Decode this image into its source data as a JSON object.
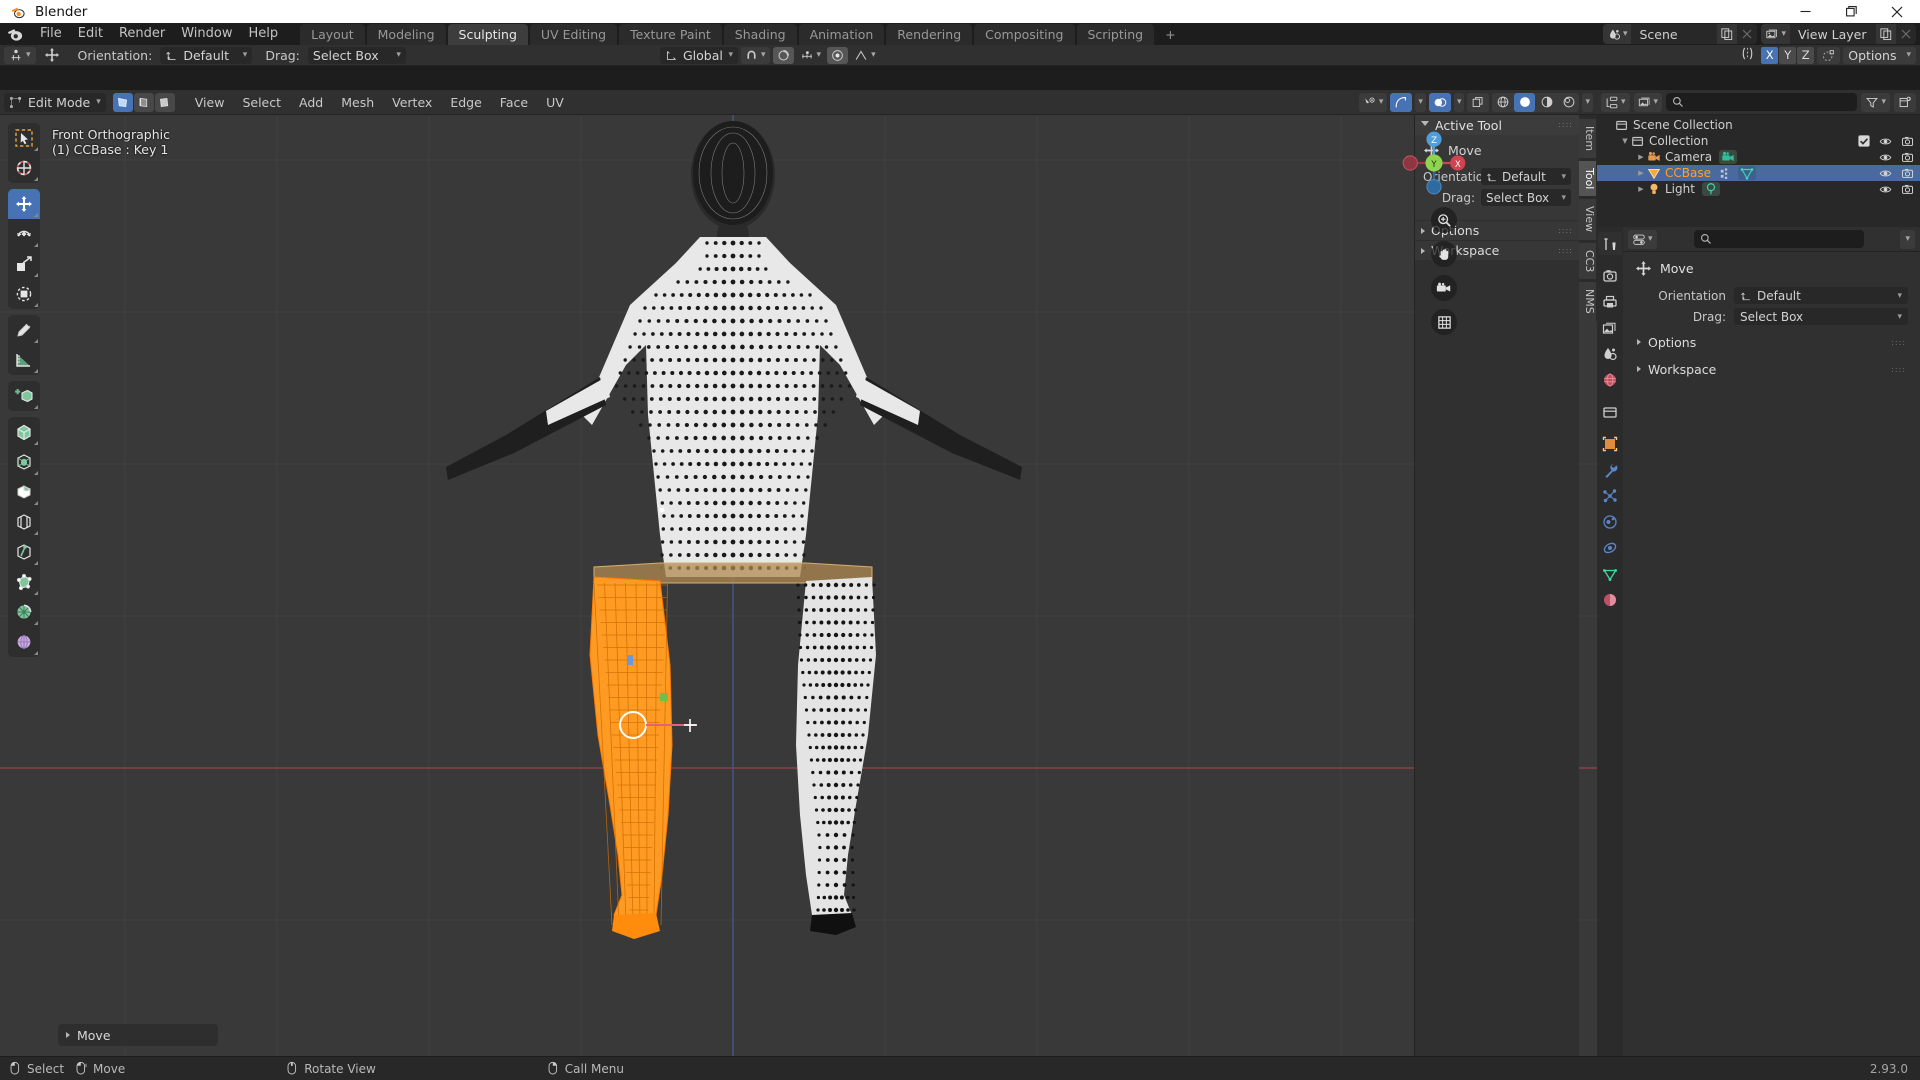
{
  "window": {
    "title": "Blender",
    "minimize": "minimize",
    "maximize": "maximize",
    "close": "close"
  },
  "topbar": {
    "menus": [
      "File",
      "Edit",
      "Render",
      "Window",
      "Help"
    ],
    "workspaces": [
      {
        "label": "Layout",
        "active": false
      },
      {
        "label": "Modeling",
        "active": false
      },
      {
        "label": "Sculpting",
        "active": true
      },
      {
        "label": "UV Editing",
        "active": false
      },
      {
        "label": "Texture Paint",
        "active": false
      },
      {
        "label": "Shading",
        "active": false
      },
      {
        "label": "Animation",
        "active": false
      },
      {
        "label": "Rendering",
        "active": false
      },
      {
        "label": "Compositing",
        "active": false
      },
      {
        "label": "Scripting",
        "active": false
      },
      {
        "label": "+",
        "active": false
      }
    ],
    "scene": "Scene",
    "view_layer": "View Layer"
  },
  "tool_settings": {
    "orientation_label": "Orientation:",
    "orientation_value": "Default",
    "drag_label": "Drag:",
    "drag_value": "Select Box",
    "transform_orientation": "Global",
    "proportional_falloff": "∧",
    "axes": [
      "X",
      "Y",
      "Z"
    ],
    "active_axis": "X",
    "options_label": "Options"
  },
  "viewport_header": {
    "mode": "Edit Mode",
    "menus": [
      "View",
      "Select",
      "Add",
      "Mesh",
      "Vertex",
      "Edge",
      "Face",
      "UV"
    ],
    "shading_modes": [
      "wireframe",
      "solid",
      "material",
      "rendered"
    ],
    "active_shading": "solid"
  },
  "viewport": {
    "overlay_line1": "Front Orthographic",
    "overlay_line2": "(1) CCBase : Key 1",
    "gizmo_axes": [
      "Z",
      "Y",
      "X"
    ],
    "operator_panel": "Move"
  },
  "toolbar": [
    {
      "name": "tweak",
      "icon": "cursor-select-icon",
      "selected": false
    },
    {
      "name": "cursor",
      "icon": "3d-cursor-icon",
      "selected": false
    },
    {
      "name": "move",
      "icon": "move-icon",
      "selected": true
    },
    {
      "name": "rotate",
      "icon": "rotate-icon",
      "selected": false
    },
    {
      "name": "scale",
      "icon": "scale-icon",
      "selected": false
    },
    {
      "name": "transform",
      "icon": "transform-icon",
      "selected": false
    },
    {
      "name": "annotate",
      "icon": "annotate-icon",
      "selected": false
    },
    {
      "name": "measure",
      "icon": "measure-icon",
      "selected": false
    },
    {
      "name": "add-cube",
      "icon": "add-cube-icon",
      "selected": false
    },
    {
      "name": "extrude-region",
      "icon": "extrude-icon",
      "selected": false
    },
    {
      "name": "inset-faces",
      "icon": "inset-icon",
      "selected": false
    },
    {
      "name": "bevel",
      "icon": "bevel-icon",
      "selected": false
    },
    {
      "name": "loop-cut",
      "icon": "loop-cut-icon",
      "selected": false
    },
    {
      "name": "knife",
      "icon": "knife-icon",
      "selected": false
    },
    {
      "name": "poly-build",
      "icon": "poly-build-icon",
      "selected": false
    },
    {
      "name": "spin",
      "icon": "spin-icon",
      "selected": false
    },
    {
      "name": "smooth",
      "icon": "smooth-icon",
      "selected": false
    }
  ],
  "npanel": {
    "tabs": [
      {
        "label": "Item",
        "active": false
      },
      {
        "label": "Tool",
        "active": true
      },
      {
        "label": "View",
        "active": false
      },
      {
        "label": "CC3",
        "active": false
      },
      {
        "label": "NMS",
        "active": false
      }
    ],
    "active_tool_header": "Active Tool",
    "tool_name": "Move",
    "orientation_label": "Orientation",
    "orientation_value": "Default",
    "drag_label": "Drag:",
    "drag_value": "Select Box",
    "options": "Options",
    "workspace": "Workspace"
  },
  "outliner": {
    "filter_label": "filter",
    "search_placeholder": "",
    "rows": [
      {
        "label": "Scene Collection",
        "depth": 0,
        "icon": "collection-icon",
        "selected": false,
        "has_disclosure": false,
        "show_checkbox": false,
        "show_eye": false,
        "show_camera": false
      },
      {
        "label": "Collection",
        "depth": 1,
        "icon": "collection-icon",
        "selected": false,
        "has_disclosure": true,
        "show_checkbox": true,
        "show_eye": true,
        "show_camera": true
      },
      {
        "label": "Camera",
        "depth": 2,
        "icon": "camera-object-icon",
        "selected": false,
        "has_disclosure": true,
        "show_checkbox": false,
        "show_eye": true,
        "show_camera": true,
        "data_icon": "camera-data-icon"
      },
      {
        "label": "CCBase",
        "depth": 2,
        "icon": "mesh-object-icon",
        "selected": true,
        "has_disclosure": true,
        "show_checkbox": false,
        "show_eye": true,
        "show_camera": true,
        "data_icon": "mesh-data-icon",
        "modifier_icon": "modifier-icon"
      },
      {
        "label": "Light",
        "depth": 2,
        "icon": "light-object-icon",
        "selected": false,
        "has_disclosure": true,
        "show_checkbox": false,
        "show_eye": true,
        "show_camera": true,
        "data_icon": "light-data-icon"
      }
    ]
  },
  "properties": {
    "tabs": [
      {
        "name": "tool",
        "icon": "tool-icon",
        "active": true
      },
      {
        "name": "render",
        "icon": "render-icon",
        "active": false
      },
      {
        "name": "output",
        "icon": "output-icon",
        "active": false
      },
      {
        "name": "view-layer",
        "icon": "view-layer-icon",
        "active": false
      },
      {
        "name": "scene",
        "icon": "scene-icon",
        "active": false
      },
      {
        "name": "world",
        "icon": "world-icon",
        "active": false
      },
      {
        "name": "collection",
        "icon": "collection-props-icon",
        "active": false
      },
      {
        "name": "object",
        "icon": "object-icon",
        "active": false
      },
      {
        "name": "modifiers",
        "icon": "wrench-icon",
        "active": false
      },
      {
        "name": "particles",
        "icon": "particles-icon",
        "active": false
      },
      {
        "name": "physics",
        "icon": "physics-icon",
        "active": false
      },
      {
        "name": "constraints",
        "icon": "constraints-icon",
        "active": false
      },
      {
        "name": "data",
        "icon": "mesh-data-icon",
        "active": false
      },
      {
        "name": "material",
        "icon": "material-icon",
        "active": false
      }
    ],
    "search_placeholder": "",
    "tool_name": "Move",
    "orientation_label": "Orientation",
    "orientation_value": "Default",
    "drag_label": "Drag:",
    "drag_value": "Select Box",
    "options": "Options",
    "workspace": "Workspace"
  },
  "statusbar": {
    "items": [
      {
        "icon": "mouse-left-icon",
        "label": "Select"
      },
      {
        "icon": "mouse-left-drag-icon",
        "label": "Move"
      },
      {
        "icon": "mouse-middle-icon",
        "label": "Rotate View"
      },
      {
        "icon": "mouse-right-icon",
        "label": "Call Menu"
      }
    ],
    "version": "2.93.0"
  },
  "colors": {
    "accent_blue": "#4772b3",
    "selection_orange": "#ffa028",
    "viewport_bg": "#393939",
    "panel_bg": "#303030",
    "header_bg": "#1d1d1d"
  }
}
